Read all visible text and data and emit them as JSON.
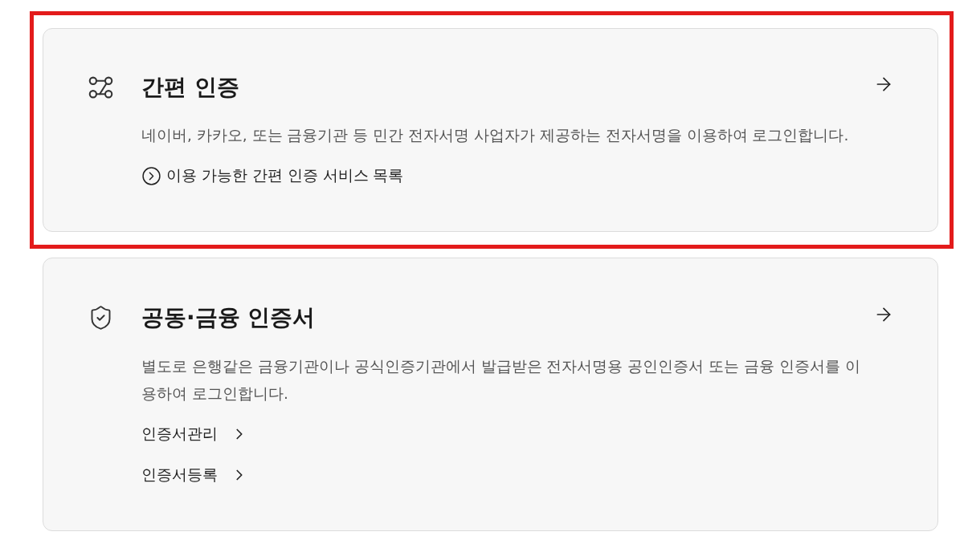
{
  "cards": [
    {
      "kind": "easy",
      "highlighted": true,
      "title": "간편 인증",
      "description": "네이버, 카카오, 또는 금융기관 등 민간 전자서명 사업자가 제공하는 전자서명을 이용하여 로그인합니다.",
      "links": [
        {
          "kind": "info",
          "label": "이용 가능한 간편 인증 서비스 목록"
        }
      ]
    },
    {
      "kind": "certificate",
      "highlighted": false,
      "title": "공동·금융 인증서",
      "description": "별도로 은행같은 금융기관이나 공식인증기관에서 발급받은 전자서명용 공인인증서 또는 금융 인증서를 이용하여 로그인합니다.",
      "links": [
        {
          "kind": "nav",
          "label": "인증서관리"
        },
        {
          "kind": "nav",
          "label": "인증서등록"
        }
      ]
    }
  ]
}
